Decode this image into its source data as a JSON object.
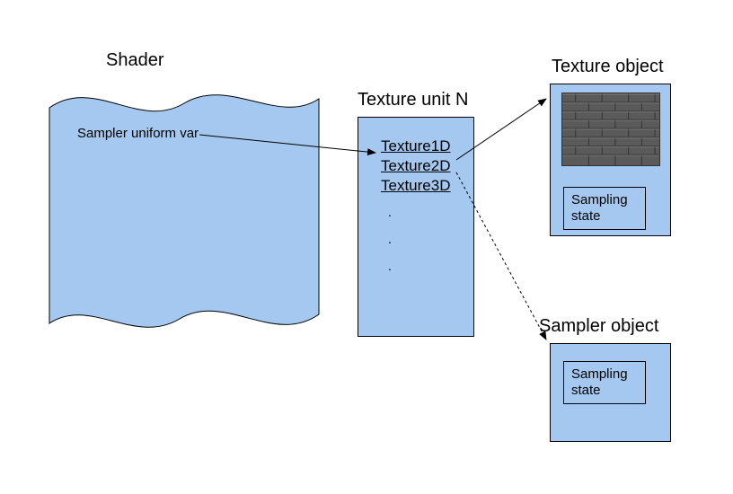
{
  "shader": {
    "title": "Shader",
    "sampler_label": "Sampler uniform var"
  },
  "texture_unit": {
    "title": "Texture unit N",
    "items": [
      "Texture1D",
      "Texture2D",
      "Texture3D"
    ]
  },
  "texture_object": {
    "title": "Texture object",
    "sampling_label": "Sampling\nstate"
  },
  "sampler_object": {
    "title": "Sampler object",
    "sampling_label": "Sampling\nstate"
  }
}
